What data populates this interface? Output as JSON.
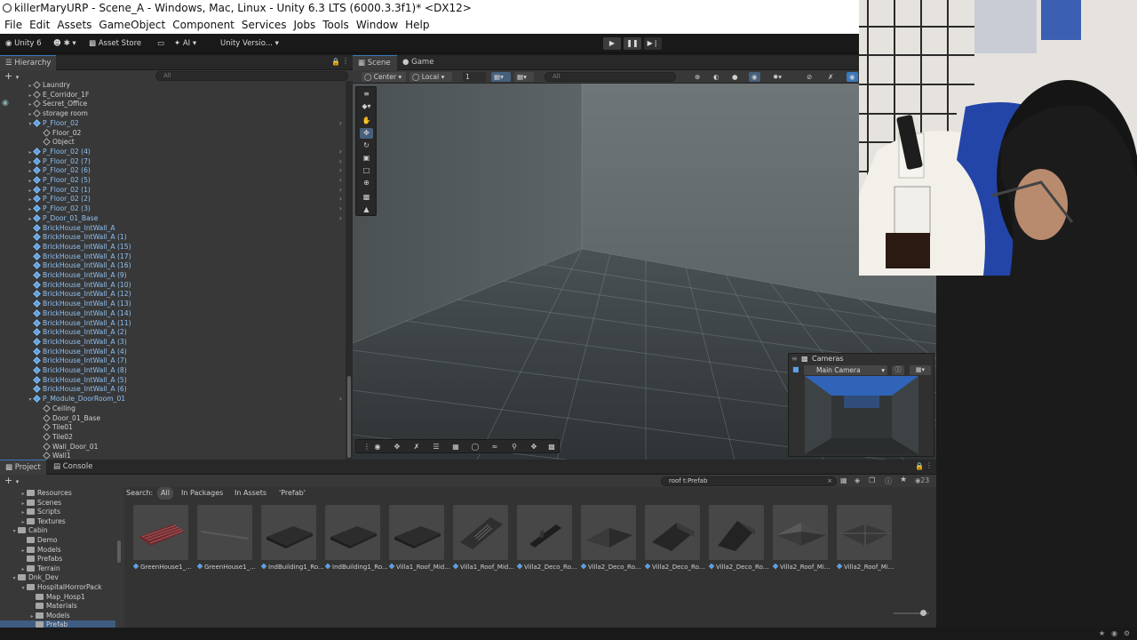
{
  "window": {
    "title": "killerMaryURP - Scene_A - Windows, Mac, Linux - Unity 6.3 LTS (6000.3.3f1)* <DX12>"
  },
  "menu": [
    "File",
    "Edit",
    "Assets",
    "GameObject",
    "Component",
    "Services",
    "Jobs",
    "Tools",
    "Window",
    "Help"
  ],
  "toolbar": {
    "unity_label": "Unity 6",
    "account_label": "✱",
    "asset_store": "Asset Store",
    "ai_label": "AI",
    "version_control": "Unity Versio..."
  },
  "hierarchy": {
    "tab": "Hierarchy",
    "search_placeholder": "All",
    "rows": [
      {
        "label": "Laundry",
        "depth": 2,
        "kind": "go",
        "fold": "▸"
      },
      {
        "label": "E_Corridor_1F",
        "depth": 2,
        "kind": "go",
        "fold": "▸"
      },
      {
        "label": "Secret_Office",
        "depth": 2,
        "kind": "go",
        "fold": "▸"
      },
      {
        "label": "storage room",
        "depth": 2,
        "kind": "go",
        "fold": "▸"
      },
      {
        "label": "P_Floor_02",
        "depth": 2,
        "kind": "prefab",
        "fold": "▾",
        "arrow": true
      },
      {
        "label": "Floor_02",
        "depth": 3,
        "kind": "go",
        "fold": ""
      },
      {
        "label": "Object",
        "depth": 3,
        "kind": "go",
        "fold": ""
      },
      {
        "label": "P_Floor_02 (4)",
        "depth": 2,
        "kind": "prefab",
        "fold": "▸",
        "arrow": true
      },
      {
        "label": "P_Floor_02 (7)",
        "depth": 2,
        "kind": "prefab",
        "fold": "▸",
        "arrow": true
      },
      {
        "label": "P_Floor_02 (6)",
        "depth": 2,
        "kind": "prefab",
        "fold": "▸",
        "arrow": true
      },
      {
        "label": "P_Floor_02 (5)",
        "depth": 2,
        "kind": "prefab",
        "fold": "▸",
        "arrow": true
      },
      {
        "label": "P_Floor_02 (1)",
        "depth": 2,
        "kind": "prefab",
        "fold": "▸",
        "arrow": true
      },
      {
        "label": "P_Floor_02 (2)",
        "depth": 2,
        "kind": "prefab",
        "fold": "▸",
        "arrow": true
      },
      {
        "label": "P_Floor_02 (3)",
        "depth": 2,
        "kind": "prefab",
        "fold": "▸",
        "arrow": true
      },
      {
        "label": "P_Door_01_Base",
        "depth": 2,
        "kind": "prefab",
        "fold": "▸",
        "arrow": true
      },
      {
        "label": "BrickHouse_IntWall_A",
        "depth": 2,
        "kind": "prefab",
        "fold": ""
      },
      {
        "label": "BrickHouse_IntWall_A (1)",
        "depth": 2,
        "kind": "prefab",
        "fold": ""
      },
      {
        "label": "BrickHouse_IntWall_A (15)",
        "depth": 2,
        "kind": "prefab",
        "fold": ""
      },
      {
        "label": "BrickHouse_IntWall_A (17)",
        "depth": 2,
        "kind": "prefab",
        "fold": ""
      },
      {
        "label": "BrickHouse_IntWall_A (16)",
        "depth": 2,
        "kind": "prefab",
        "fold": ""
      },
      {
        "label": "BrickHouse_IntWall_A (9)",
        "depth": 2,
        "kind": "prefab",
        "fold": ""
      },
      {
        "label": "BrickHouse_IntWall_A (10)",
        "depth": 2,
        "kind": "prefab",
        "fold": ""
      },
      {
        "label": "BrickHouse_IntWall_A (12)",
        "depth": 2,
        "kind": "prefab",
        "fold": ""
      },
      {
        "label": "BrickHouse_IntWall_A (13)",
        "depth": 2,
        "kind": "prefab",
        "fold": ""
      },
      {
        "label": "BrickHouse_IntWall_A (14)",
        "depth": 2,
        "kind": "prefab",
        "fold": ""
      },
      {
        "label": "BrickHouse_IntWall_A (11)",
        "depth": 2,
        "kind": "prefab",
        "fold": ""
      },
      {
        "label": "BrickHouse_IntWall_A (2)",
        "depth": 2,
        "kind": "prefab",
        "fold": ""
      },
      {
        "label": "BrickHouse_IntWall_A (3)",
        "depth": 2,
        "kind": "prefab",
        "fold": ""
      },
      {
        "label": "BrickHouse_IntWall_A (4)",
        "depth": 2,
        "kind": "prefab",
        "fold": ""
      },
      {
        "label": "BrickHouse_IntWall_A (7)",
        "depth": 2,
        "kind": "prefab",
        "fold": ""
      },
      {
        "label": "BrickHouse_IntWall_A (8)",
        "depth": 2,
        "kind": "prefab",
        "fold": ""
      },
      {
        "label": "BrickHouse_IntWall_A (5)",
        "depth": 2,
        "kind": "prefab",
        "fold": ""
      },
      {
        "label": "BrickHouse_IntWall_A (6)",
        "depth": 2,
        "kind": "prefab",
        "fold": ""
      },
      {
        "label": "P_Module_DoorRoom_01",
        "depth": 2,
        "kind": "prefab",
        "fold": "▾",
        "arrow": true
      },
      {
        "label": "Ceiling",
        "depth": 3,
        "kind": "go",
        "fold": ""
      },
      {
        "label": "Door_01_Base",
        "depth": 3,
        "kind": "go",
        "fold": ""
      },
      {
        "label": "Tile01",
        "depth": 3,
        "kind": "go",
        "fold": ""
      },
      {
        "label": "Tile02",
        "depth": 3,
        "kind": "go",
        "fold": ""
      },
      {
        "label": "Wall_Door_01",
        "depth": 3,
        "kind": "go",
        "fold": ""
      },
      {
        "label": "Wall1",
        "depth": 3,
        "kind": "go",
        "fold": ""
      }
    ]
  },
  "scene": {
    "tab_scene": "Scene",
    "tab_game": "Game",
    "pivot": "Center",
    "space": "Local",
    "grid_snap": "1",
    "search_placeholder": "All",
    "cameras_overlay": {
      "title": "Cameras",
      "selected_camera": "Main Camera"
    }
  },
  "project": {
    "tab_project": "Project",
    "tab_console": "Console",
    "search_query": "roof t:Prefab",
    "search_label": "Search:",
    "scopes": [
      "All",
      "In Packages",
      "In Assets",
      "'Prefab'"
    ],
    "hidden_count": "23",
    "folders": [
      {
        "label": "Resources",
        "depth": 2,
        "fold": "▸"
      },
      {
        "label": "Scenes",
        "depth": 2,
        "fold": "▸"
      },
      {
        "label": "Scripts",
        "depth": 2,
        "fold": "▸"
      },
      {
        "label": "Textures",
        "depth": 2,
        "fold": "▸"
      },
      {
        "label": "Cabin",
        "depth": 1,
        "fold": "▾"
      },
      {
        "label": "Demo",
        "depth": 2,
        "fold": ""
      },
      {
        "label": "Models",
        "depth": 2,
        "fold": "▸"
      },
      {
        "label": "Prefabs",
        "depth": 2,
        "fold": ""
      },
      {
        "label": "Terrain",
        "depth": 2,
        "fold": "▸"
      },
      {
        "label": "Dnk_Dev",
        "depth": 1,
        "fold": "▾"
      },
      {
        "label": "HospitalHorrorPack",
        "depth": 2,
        "fold": "▾"
      },
      {
        "label": "Map_Hosp1",
        "depth": 3,
        "fold": ""
      },
      {
        "label": "Materials",
        "depth": 3,
        "fold": ""
      },
      {
        "label": "Models",
        "depth": 3,
        "fold": "▸"
      },
      {
        "label": "Prefab",
        "depth": 3,
        "fold": "",
        "selected": true
      }
    ],
    "assets": [
      {
        "label": "GreenHouse1_...",
        "thumb": "red-roof"
      },
      {
        "label": "GreenHouse1_...",
        "thumb": "flat-thin"
      },
      {
        "label": "IndBuilding1_Ro...",
        "thumb": "slab"
      },
      {
        "label": "IndBuilding1_Ro...",
        "thumb": "slab"
      },
      {
        "label": "Villa1_Roof_Mid...",
        "thumb": "slab"
      },
      {
        "label": "Villa1_Roof_Mid...",
        "thumb": "vent"
      },
      {
        "label": "Villa2_Deco_Ro...",
        "thumb": "beam"
      },
      {
        "label": "Villa2_Deco_Ro...",
        "thumb": "pyramid"
      },
      {
        "label": "Villa2_Deco_Ro...",
        "thumb": "ramp"
      },
      {
        "label": "Villa2_Deco_Ro...",
        "thumb": "ramp2"
      },
      {
        "label": "Villa2_Roof_Mi...",
        "thumb": "hip"
      },
      {
        "label": "Villa2_Roof_Mi...",
        "thumb": "hip2"
      }
    ]
  },
  "colors": {
    "prefab_blue": "#8fc0f2",
    "panel_bg": "#383838",
    "accent": "#3a79bb"
  }
}
